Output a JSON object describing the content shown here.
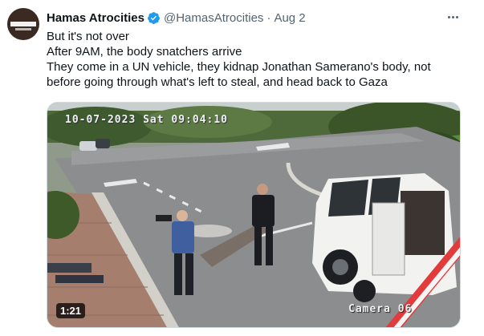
{
  "author": {
    "display_name": "Hamas Atrocities",
    "handle": "@HamasAtrocities",
    "separator": "·",
    "date": "Aug 2",
    "avatar_icon": "avatar-logo-icon",
    "verified_icon": "verified-badge-icon",
    "verified_color": "#1d9bf0"
  },
  "tweet": {
    "lines": [
      "But it's not over",
      "After 9AM, the body snatchers arrive",
      "They come in a UN vehicle, they kidnap Jonathan Samerano's body, not",
      "before going through what's left to steal, and head back to Gaza"
    ]
  },
  "media": {
    "timestamp_overlay": "10-07-2023 Sat 09:04:10",
    "camera_overlay": "Camera 06",
    "duration": "1:21"
  },
  "menu": {
    "icon": "more-options-icon"
  }
}
